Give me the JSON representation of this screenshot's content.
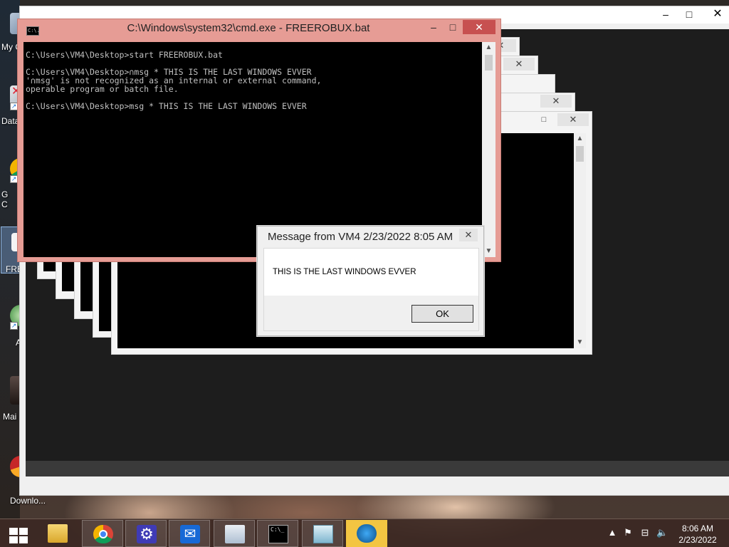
{
  "desktop": {
    "icons": [
      {
        "label": "My C"
      },
      {
        "label": "Data"
      },
      {
        "label": "G\nC"
      },
      {
        "label": "FRE"
      },
      {
        "label": "A"
      },
      {
        "label": "Mai"
      },
      {
        "label": "In\nDownlo..."
      }
    ]
  },
  "cmd_window": {
    "title": "C:\\Windows\\system32\\cmd.exe - FREEROBUX.bat",
    "icon_text": "C:\\.",
    "lines": [
      "C:\\Users\\VM4\\Desktop>start FREEROBUX.bat",
      "",
      "C:\\Users\\VM4\\Desktop>∩msg * THIS IS THE LAST WINDOWS EVVER",
      "'∩msg' is not recognized as an internal or external command,",
      "operable program or batch file.",
      "",
      "C:\\Users\\VM4\\Desktop>msg * THIS IS THE LAST WINDOWS EVVER"
    ],
    "minimize_glyph": "–",
    "maximize_glyph": "□",
    "close_glyph": "✕"
  },
  "message_box": {
    "title": "Message from VM4 2/23/2022 8:05 AM",
    "text": "THIS IS THE LAST WINDOWS EVVER",
    "ok_label": "OK",
    "close_glyph": "✕"
  },
  "background_window": {
    "minimize_glyph": "–",
    "maximize_glyph": "□",
    "close_glyph": "✕"
  },
  "taskbar": {
    "clock_time": "8:06 AM",
    "clock_date": "2/23/2022",
    "buttons": [
      "start",
      "file-explorer",
      "chrome",
      "settings",
      "mail",
      "task-manager",
      "command-prompt",
      "notepad",
      "app"
    ]
  }
}
